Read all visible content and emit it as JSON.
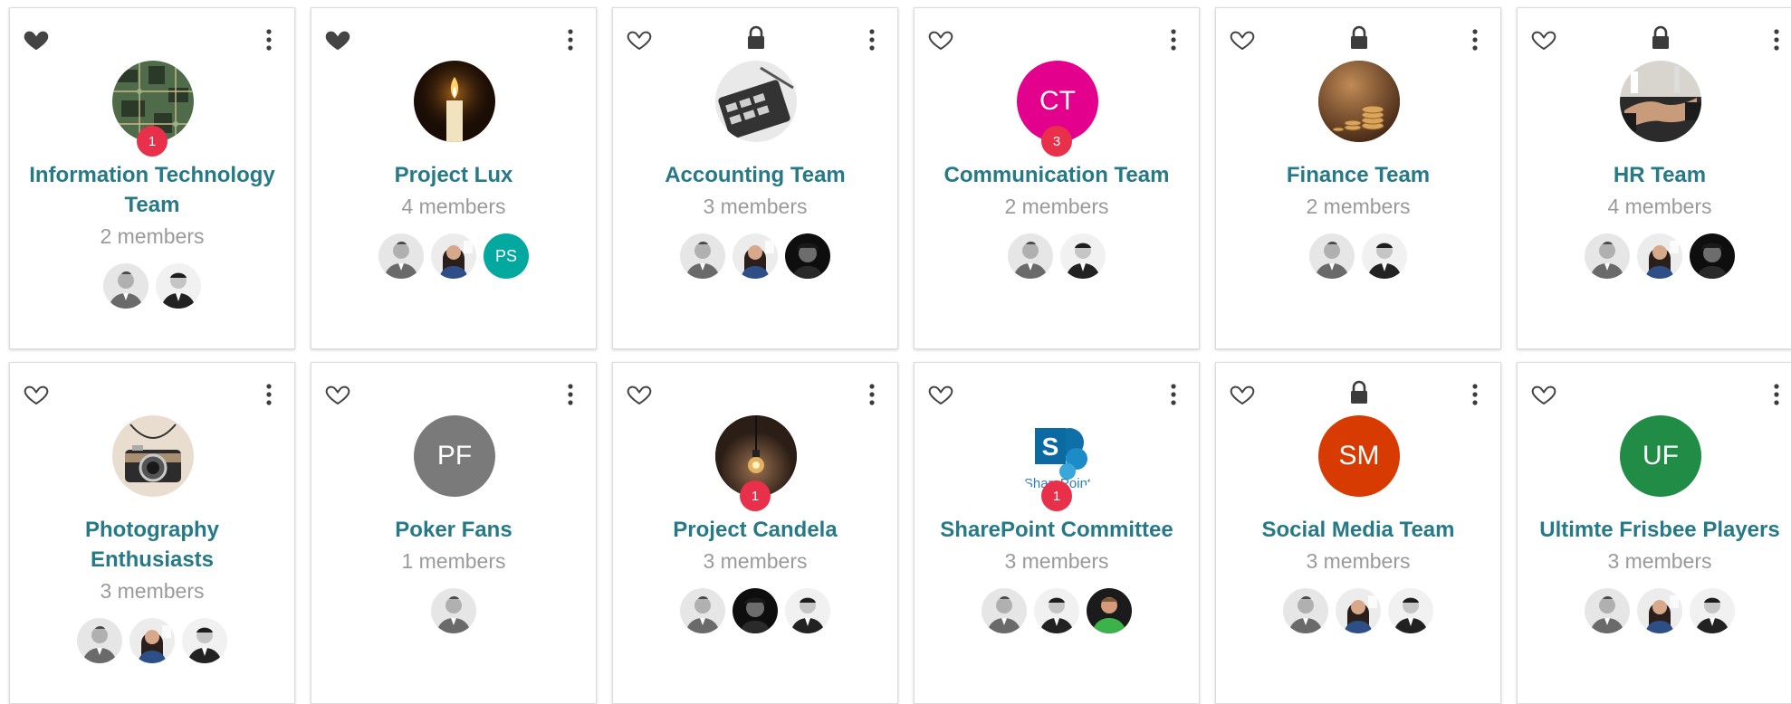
{
  "groups": [
    {
      "name": "Information Technology Team",
      "count": "2 members",
      "favorite": true,
      "locked": false,
      "avatar": {
        "kind": "photo",
        "icon": "circuit-board-photo"
      },
      "badge": "1",
      "members": [
        "man-gray-blazer-photo",
        "man-dark-suit-photo"
      ]
    },
    {
      "name": "Project Lux",
      "count": "4 members",
      "favorite": true,
      "locked": false,
      "avatar": {
        "kind": "photo",
        "icon": "candle-photo"
      },
      "badge": "",
      "members": [
        "man-gray-blazer-photo",
        "woman-smiling-photo",
        {
          "initials": "PS",
          "color": "#03a89e"
        }
      ]
    },
    {
      "name": "Accounting Team",
      "count": "3 members",
      "favorite": false,
      "locked": true,
      "avatar": {
        "kind": "photo",
        "icon": "calculator-photo"
      },
      "badge": "",
      "members": [
        "man-gray-blazer-photo",
        "woman-smiling-photo",
        "man-curly-hair-photo"
      ]
    },
    {
      "name": "Communication Team",
      "count": "2 members",
      "favorite": false,
      "locked": false,
      "avatar": {
        "kind": "initials",
        "initials": "CT",
        "color": "#e3008c"
      },
      "badge": "3",
      "members": [
        "man-gray-blazer-photo",
        "man-dark-suit-photo"
      ]
    },
    {
      "name": "Finance Team",
      "count": "2 members",
      "favorite": false,
      "locked": true,
      "avatar": {
        "kind": "photo",
        "icon": "coins-photo"
      },
      "badge": "",
      "members": [
        "man-gray-blazer-photo",
        "man-dark-suit-photo"
      ]
    },
    {
      "name": "HR Team",
      "count": "4 members",
      "favorite": false,
      "locked": true,
      "avatar": {
        "kind": "photo",
        "icon": "handshake-photo"
      },
      "badge": "",
      "members": [
        "man-gray-blazer-photo",
        "woman-smiling-photo",
        "man-curly-hair-photo"
      ]
    },
    {
      "name": "Photography Enthusiasts",
      "count": "3 members",
      "favorite": false,
      "locked": false,
      "avatar": {
        "kind": "photo",
        "icon": "camera-photo"
      },
      "badge": "",
      "members": [
        "man-gray-blazer-photo",
        "woman-smiling-photo",
        "man-dark-suit-photo"
      ]
    },
    {
      "name": "Poker Fans",
      "count": "1 members",
      "favorite": false,
      "locked": false,
      "avatar": {
        "kind": "initials",
        "initials": "PF",
        "color": "#7a7a7a"
      },
      "badge": "",
      "members": [
        "man-gray-blazer-photo"
      ]
    },
    {
      "name": "Project Candela",
      "count": "3 members",
      "favorite": false,
      "locked": false,
      "avatar": {
        "kind": "photo",
        "icon": "light-bulb-photo"
      },
      "badge": "1",
      "members": [
        "man-gray-blazer-photo",
        "man-curly-hair-photo",
        "man-dark-suit-photo"
      ]
    },
    {
      "name": "SharePoint Committee",
      "count": "3 members",
      "favorite": false,
      "locked": false,
      "avatar": {
        "kind": "logo",
        "icon": "sharepoint-logo",
        "logo_text": "SharePoint"
      },
      "badge": "1",
      "members": [
        "man-gray-blazer-photo",
        "man-dark-suit-photo",
        "man-green-shirt-photo"
      ]
    },
    {
      "name": "Social Media Team",
      "count": "3 members",
      "favorite": false,
      "locked": true,
      "avatar": {
        "kind": "initials",
        "initials": "SM",
        "color": "#d83b01"
      },
      "badge": "",
      "members": [
        "man-gray-blazer-photo",
        "woman-smiling-photo",
        "man-dark-suit-photo"
      ]
    },
    {
      "name": "Ultimte Frisbee Players",
      "count": "3 members",
      "favorite": false,
      "locked": false,
      "avatar": {
        "kind": "initials",
        "initials": "UF",
        "color": "#218c45"
      },
      "badge": "",
      "members": [
        "man-gray-blazer-photo",
        "woman-smiling-photo",
        "man-dark-suit-photo"
      ]
    }
  ],
  "colors": {
    "title": "#267a87",
    "count": "#9a9a9a",
    "badge": "#e8304a",
    "icon": "#3c3c3c"
  }
}
